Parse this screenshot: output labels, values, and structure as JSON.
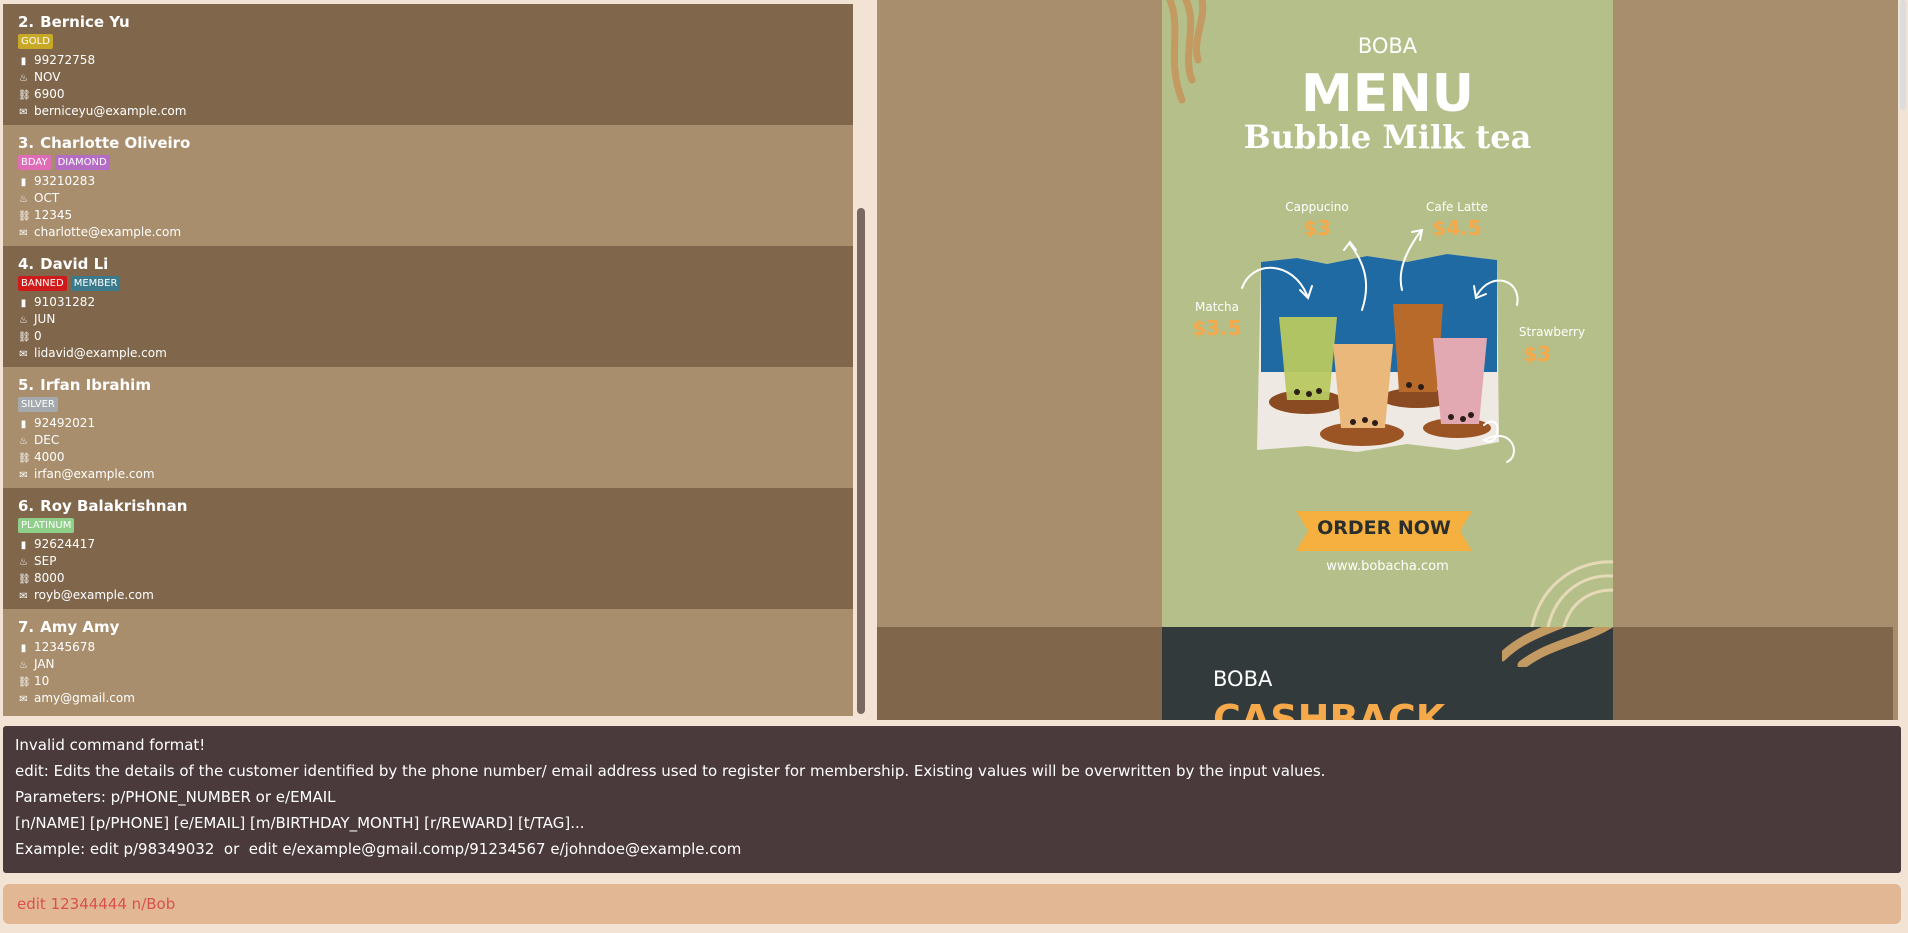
{
  "customers": [
    {
      "index": "2.",
      "name": "Bernice Yu",
      "tags": [
        {
          "label": "GOLD",
          "color": "#c8a827"
        }
      ],
      "phone": "99272758",
      "birthday": "NOV",
      "reward": "6900",
      "email": "berniceyu@example.com"
    },
    {
      "index": "3.",
      "name": "Charlotte Oliveiro",
      "tags": [
        {
          "label": "BDAY",
          "color": "#e06bb6"
        },
        {
          "label": "DIAMOND",
          "color": "#b46cc4"
        }
      ],
      "phone": "93210283",
      "birthday": "OCT",
      "reward": "12345",
      "email": "charlotte@example.com"
    },
    {
      "index": "4.",
      "name": "David Li",
      "tags": [
        {
          "label": "BANNED",
          "color": "#d01a1a"
        },
        {
          "label": "MEMBER",
          "color": "#3b7a8c"
        }
      ],
      "phone": "91031282",
      "birthday": "JUN",
      "reward": "0",
      "email": "lidavid@example.com"
    },
    {
      "index": "5.",
      "name": "Irfan Ibrahim",
      "tags": [
        {
          "label": "SILVER",
          "color": "#a3a9ad"
        }
      ],
      "phone": "92492021",
      "birthday": "DEC",
      "reward": "4000",
      "email": "irfan@example.com"
    },
    {
      "index": "6.",
      "name": "Roy Balakrishnan",
      "tags": [
        {
          "label": "PLATINUM",
          "color": "#8fcf8a"
        }
      ],
      "phone": "92624417",
      "birthday": "SEP",
      "reward": "8000",
      "email": "royb@example.com"
    },
    {
      "index": "7.",
      "name": "Amy Amy",
      "tags": [],
      "phone": "12345678",
      "birthday": "JAN",
      "reward": "10",
      "email": "amy@gmail.com"
    }
  ],
  "icons": {
    "phone": "phone-icon",
    "birthday": "cake-icon",
    "reward": "gift-icon",
    "email": "email-icon"
  },
  "poster": {
    "brand": "BOBA",
    "title": "MENU",
    "subtitle": "Bubble Milk tea",
    "items": [
      {
        "name": "Cappucino",
        "price": "$3"
      },
      {
        "name": "Cafe Latte",
        "price": "$4.5"
      },
      {
        "name": "Matcha",
        "price": "$3.5"
      },
      {
        "name": "Strawberry",
        "price": "$3"
      }
    ],
    "cta": "ORDER NOW",
    "website": "www.bobacha.com",
    "brand2": "BOBA",
    "title2": "CASHBACK"
  },
  "result": {
    "lines": [
      "Invalid command format!",
      "edit: Edits the details of the customer identified by the phone number/ email address used to register for membership. Existing values will be overwritten by the input values.",
      "Parameters: p/PHONE_NUMBER or e/EMAIL",
      "[n/NAME] [p/PHONE] [e/EMAIL] [m/BIRTHDAY_MONTH] [r/REWARD] [t/TAG]...",
      "Example: edit p/98349032  or  edit e/example@gmail.comp/91234567 e/johndoe@example.com"
    ]
  },
  "command": {
    "value": "edit 12344444 n/Bob"
  }
}
